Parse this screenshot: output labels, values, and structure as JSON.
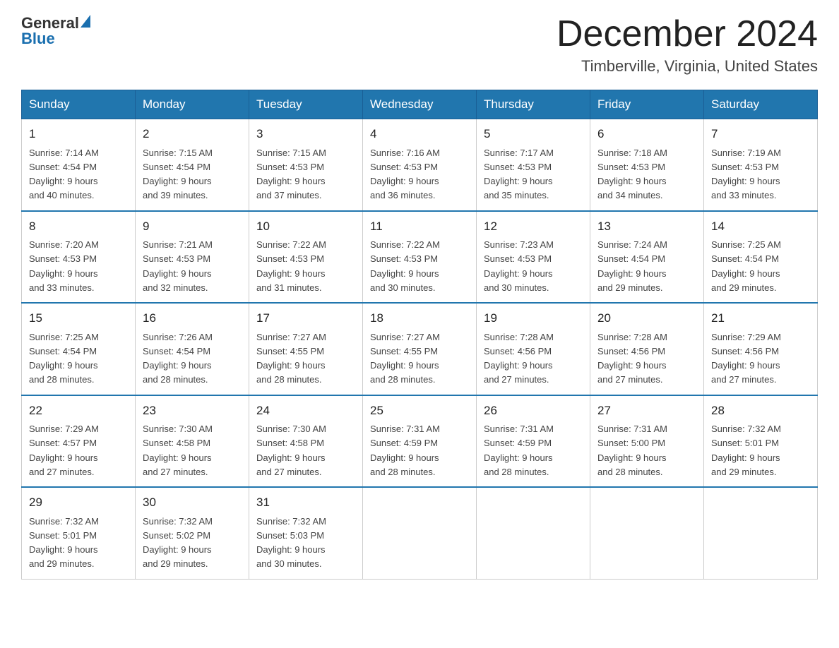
{
  "header": {
    "logo_general": "General",
    "logo_blue": "Blue",
    "month_title": "December 2024",
    "location": "Timberville, Virginia, United States"
  },
  "days_of_week": [
    "Sunday",
    "Monday",
    "Tuesday",
    "Wednesday",
    "Thursday",
    "Friday",
    "Saturday"
  ],
  "weeks": [
    [
      {
        "day": "1",
        "sunrise": "7:14 AM",
        "sunset": "4:54 PM",
        "daylight": "9 hours and 40 minutes."
      },
      {
        "day": "2",
        "sunrise": "7:15 AM",
        "sunset": "4:54 PM",
        "daylight": "9 hours and 39 minutes."
      },
      {
        "day": "3",
        "sunrise": "7:15 AM",
        "sunset": "4:53 PM",
        "daylight": "9 hours and 37 minutes."
      },
      {
        "day": "4",
        "sunrise": "7:16 AM",
        "sunset": "4:53 PM",
        "daylight": "9 hours and 36 minutes."
      },
      {
        "day": "5",
        "sunrise": "7:17 AM",
        "sunset": "4:53 PM",
        "daylight": "9 hours and 35 minutes."
      },
      {
        "day": "6",
        "sunrise": "7:18 AM",
        "sunset": "4:53 PM",
        "daylight": "9 hours and 34 minutes."
      },
      {
        "day": "7",
        "sunrise": "7:19 AM",
        "sunset": "4:53 PM",
        "daylight": "9 hours and 33 minutes."
      }
    ],
    [
      {
        "day": "8",
        "sunrise": "7:20 AM",
        "sunset": "4:53 PM",
        "daylight": "9 hours and 33 minutes."
      },
      {
        "day": "9",
        "sunrise": "7:21 AM",
        "sunset": "4:53 PM",
        "daylight": "9 hours and 32 minutes."
      },
      {
        "day": "10",
        "sunrise": "7:22 AM",
        "sunset": "4:53 PM",
        "daylight": "9 hours and 31 minutes."
      },
      {
        "day": "11",
        "sunrise": "7:22 AM",
        "sunset": "4:53 PM",
        "daylight": "9 hours and 30 minutes."
      },
      {
        "day": "12",
        "sunrise": "7:23 AM",
        "sunset": "4:53 PM",
        "daylight": "9 hours and 30 minutes."
      },
      {
        "day": "13",
        "sunrise": "7:24 AM",
        "sunset": "4:54 PM",
        "daylight": "9 hours and 29 minutes."
      },
      {
        "day": "14",
        "sunrise": "7:25 AM",
        "sunset": "4:54 PM",
        "daylight": "9 hours and 29 minutes."
      }
    ],
    [
      {
        "day": "15",
        "sunrise": "7:25 AM",
        "sunset": "4:54 PM",
        "daylight": "9 hours and 28 minutes."
      },
      {
        "day": "16",
        "sunrise": "7:26 AM",
        "sunset": "4:54 PM",
        "daylight": "9 hours and 28 minutes."
      },
      {
        "day": "17",
        "sunrise": "7:27 AM",
        "sunset": "4:55 PM",
        "daylight": "9 hours and 28 minutes."
      },
      {
        "day": "18",
        "sunrise": "7:27 AM",
        "sunset": "4:55 PM",
        "daylight": "9 hours and 28 minutes."
      },
      {
        "day": "19",
        "sunrise": "7:28 AM",
        "sunset": "4:56 PM",
        "daylight": "9 hours and 27 minutes."
      },
      {
        "day": "20",
        "sunrise": "7:28 AM",
        "sunset": "4:56 PM",
        "daylight": "9 hours and 27 minutes."
      },
      {
        "day": "21",
        "sunrise": "7:29 AM",
        "sunset": "4:56 PM",
        "daylight": "9 hours and 27 minutes."
      }
    ],
    [
      {
        "day": "22",
        "sunrise": "7:29 AM",
        "sunset": "4:57 PM",
        "daylight": "9 hours and 27 minutes."
      },
      {
        "day": "23",
        "sunrise": "7:30 AM",
        "sunset": "4:58 PM",
        "daylight": "9 hours and 27 minutes."
      },
      {
        "day": "24",
        "sunrise": "7:30 AM",
        "sunset": "4:58 PM",
        "daylight": "9 hours and 27 minutes."
      },
      {
        "day": "25",
        "sunrise": "7:31 AM",
        "sunset": "4:59 PM",
        "daylight": "9 hours and 28 minutes."
      },
      {
        "day": "26",
        "sunrise": "7:31 AM",
        "sunset": "4:59 PM",
        "daylight": "9 hours and 28 minutes."
      },
      {
        "day": "27",
        "sunrise": "7:31 AM",
        "sunset": "5:00 PM",
        "daylight": "9 hours and 28 minutes."
      },
      {
        "day": "28",
        "sunrise": "7:32 AM",
        "sunset": "5:01 PM",
        "daylight": "9 hours and 29 minutes."
      }
    ],
    [
      {
        "day": "29",
        "sunrise": "7:32 AM",
        "sunset": "5:01 PM",
        "daylight": "9 hours and 29 minutes."
      },
      {
        "day": "30",
        "sunrise": "7:32 AM",
        "sunset": "5:02 PM",
        "daylight": "9 hours and 29 minutes."
      },
      {
        "day": "31",
        "sunrise": "7:32 AM",
        "sunset": "5:03 PM",
        "daylight": "9 hours and 30 minutes."
      },
      null,
      null,
      null,
      null
    ]
  ],
  "labels": {
    "sunrise": "Sunrise:",
    "sunset": "Sunset:",
    "daylight": "Daylight:"
  }
}
